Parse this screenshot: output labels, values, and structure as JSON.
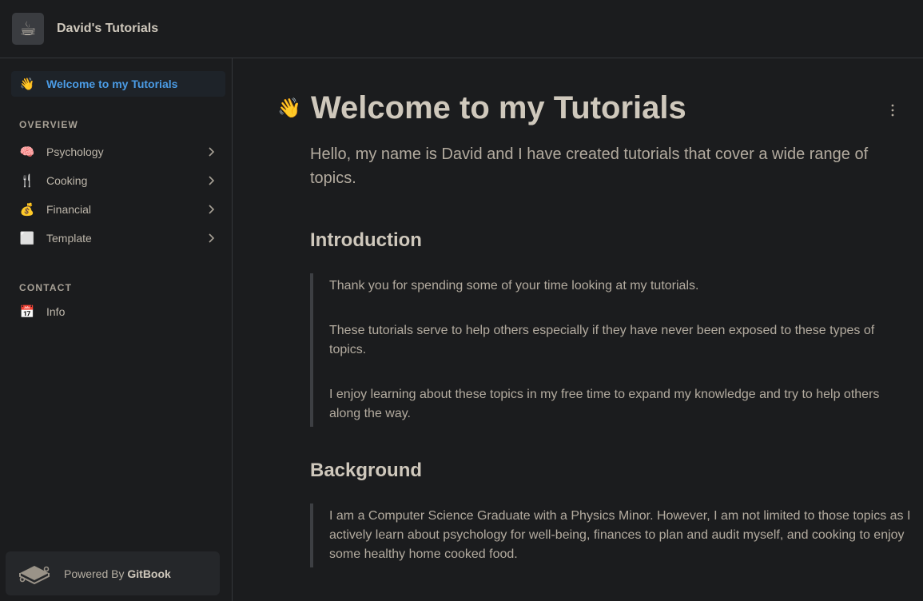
{
  "header": {
    "logo_emoji": "☕",
    "site_title": "David's Tutorials"
  },
  "sidebar": {
    "active_item": {
      "emoji": "👋",
      "label": "Welcome to my Tutorials"
    },
    "overview_heading": "OVERVIEW",
    "overview_items": [
      {
        "emoji": "🧠",
        "label": "Psychology"
      },
      {
        "emoji": "🍴",
        "label": "Cooking"
      },
      {
        "emoji": "💰",
        "label": "Financial"
      },
      {
        "emoji": "⬜",
        "label": "Template"
      }
    ],
    "contact_heading": "CONTACT",
    "contact_items": [
      {
        "emoji": "📅",
        "label": "Info"
      }
    ],
    "powered_by": {
      "prefix": "Powered By",
      "brand": "GitBook"
    }
  },
  "page": {
    "title_emoji": "👋",
    "title": "Welcome to my Tutorials",
    "lead": "Hello, my name is David and I have created tutorials that cover a wide range of topics.",
    "sections": [
      {
        "heading": "Introduction",
        "paragraphs": [
          "Thank you for spending some of your time looking at my tutorials.",
          "These tutorials serve to help others especially if they have never been exposed to these types of topics.",
          "I enjoy learning about these topics in my free time to expand my knowledge and try to help others along the way."
        ]
      },
      {
        "heading": "Background",
        "paragraphs": [
          "I am a Computer Science Graduate with a Physics Minor. However, I am not limited to those topics as I actively learn about psychology for well-being, finances to plan and audit myself, and cooking to enjoy some healthy home cooked food."
        ]
      }
    ]
  },
  "colors": {
    "background": "#1b1c1e",
    "accent": "#4b9ce6",
    "text": "#c9c2b6"
  }
}
